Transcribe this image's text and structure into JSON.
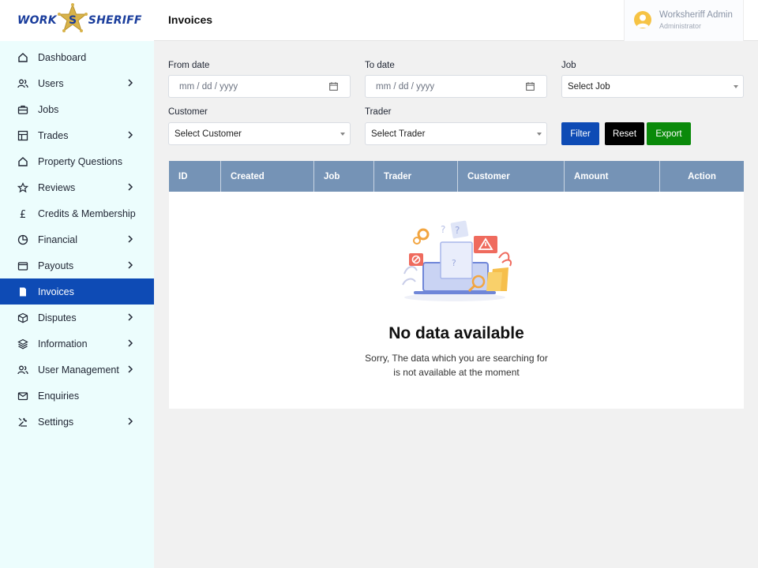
{
  "brand": {
    "left": "WORK",
    "right": "SHERIFF"
  },
  "header": {
    "title": "Invoices"
  },
  "user": {
    "name": "Worksheriff Admin",
    "role": "Administrator"
  },
  "sidebar": {
    "items": [
      {
        "label": "Dashboard",
        "icon": "home-icon"
      },
      {
        "label": "Users",
        "icon": "users-icon"
      },
      {
        "label": "Jobs",
        "icon": "briefcase-icon"
      },
      {
        "label": "Trades",
        "icon": "table-icon"
      },
      {
        "label": "Property Questions",
        "icon": "home-icon"
      },
      {
        "label": "Reviews",
        "icon": "star-icon"
      },
      {
        "label": "Credits & Membership",
        "icon": "pound-icon"
      },
      {
        "label": "Financial",
        "icon": "pie-chart-icon"
      },
      {
        "label": "Payouts",
        "icon": "wallet-icon"
      },
      {
        "label": "Invoices",
        "icon": "document-icon"
      },
      {
        "label": "Disputes",
        "icon": "box-icon"
      },
      {
        "label": "Information",
        "icon": "layers-icon"
      },
      {
        "label": "User Management",
        "icon": "users-icon"
      },
      {
        "label": "Enquiries",
        "icon": "mail-icon"
      },
      {
        "label": "Settings",
        "icon": "tools-icon"
      }
    ]
  },
  "filters": {
    "from_date": {
      "label": "From date",
      "placeholder": "mm / dd / yyyy"
    },
    "to_date": {
      "label": "To date",
      "placeholder": "mm / dd / yyyy"
    },
    "job": {
      "label": "Job",
      "value": "Select Job"
    },
    "customer": {
      "label": "Customer",
      "value": "Select Customer"
    },
    "trader": {
      "label": "Trader",
      "value": "Select Trader"
    },
    "buttons": {
      "filter": "Filter",
      "reset": "Reset",
      "export": "Export"
    }
  },
  "table": {
    "columns": [
      "ID",
      "Created",
      "Job",
      "Trader",
      "Customer",
      "Amount",
      "Action"
    ],
    "empty": {
      "title": "No data available",
      "line1": "Sorry, The data which you are searching for",
      "line2": "is not available at the moment"
    }
  },
  "colors": {
    "accent": "#0e4bb5",
    "sidebar_bg": "#ecfdfd",
    "table_header": "#7593b6",
    "filter_button": "#0e4bb5",
    "reset_button": "#000000",
    "export_button": "#0a8a0a"
  }
}
